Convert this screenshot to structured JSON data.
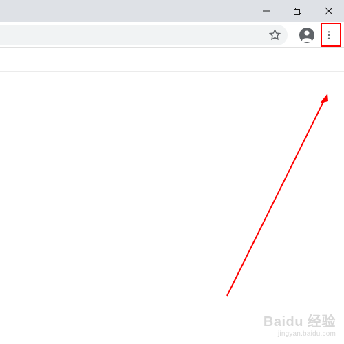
{
  "icons": {
    "minimize": "minimize-icon",
    "maximize": "maximize-icon",
    "close": "close-icon",
    "bookmark": "star-icon",
    "profile": "profile-icon",
    "menu": "more-vert-icon"
  },
  "annotation": {
    "highlight_color": "#ff0000",
    "arrow_color": "#ff0000"
  },
  "watermark": {
    "main": "Baidu 经验",
    "sub": "jingyan.baidu.com"
  }
}
